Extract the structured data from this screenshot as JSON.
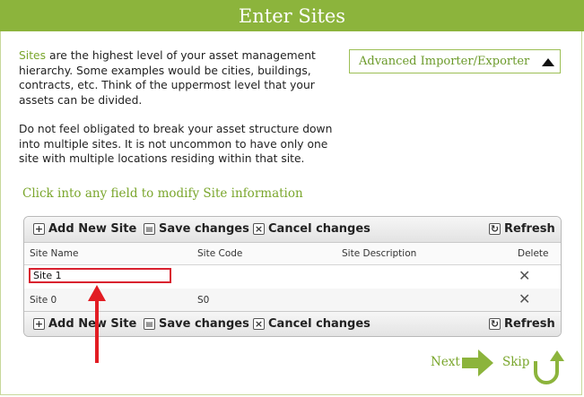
{
  "header": {
    "title": "Enter Sites"
  },
  "intro": {
    "p1_highlight": "Sites",
    "p1_rest": " are the highest level of your asset management hierarchy. Some examples would be cities, buildings, contracts, etc. Think of the uppermost level that your assets can be divided.",
    "p2": "Do not feel obligated to break your asset structure down into multiple sites. It is not uncommon to have only one site with multiple locations residing within that site."
  },
  "advanced": {
    "label": "Advanced Importer/Exporter",
    "icon": "triangle-up-icon"
  },
  "hint": "Click into any field to modify Site information",
  "toolbar": {
    "add_label": "Add New Site",
    "save_label": "Save changes",
    "cancel_label": "Cancel changes",
    "refresh_label": "Refresh"
  },
  "columns": {
    "name": "Site Name",
    "code": "Site Code",
    "description": "Site Description",
    "delete": "Delete"
  },
  "rows": [
    {
      "name": "Site 1",
      "code": "",
      "description": ""
    },
    {
      "name": "Site 0",
      "code": "S0",
      "description": ""
    }
  ],
  "nav": {
    "next": "Next",
    "skip": "Skip"
  },
  "colors": {
    "brand": "#8cb43c",
    "accent_text": "#7aa62c",
    "highlight": "#e21c23"
  }
}
